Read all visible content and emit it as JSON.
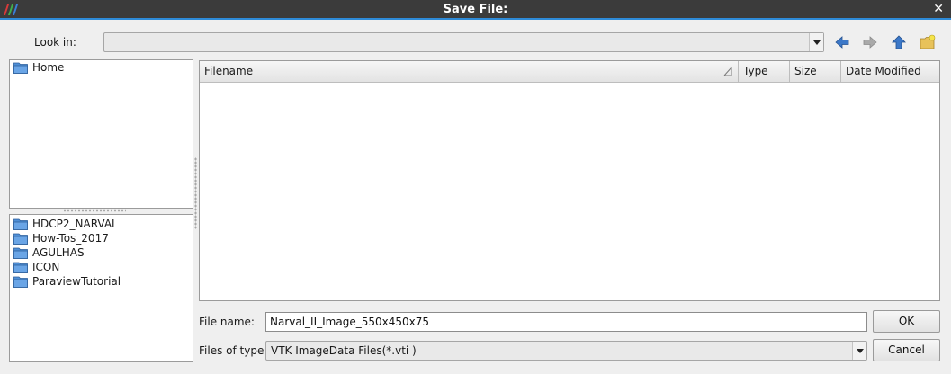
{
  "window": {
    "title": "Save File:",
    "close_glyph": "✕"
  },
  "look_in": {
    "label": "Look in:",
    "value": ""
  },
  "toolbar": {
    "icons": [
      "back-arrow-icon",
      "forward-arrow-icon",
      "parent-directory-icon",
      "new-folder-icon"
    ]
  },
  "places": {
    "top": [
      {
        "label": "Home",
        "icon": "folder-icon"
      }
    ],
    "bottom": [
      {
        "label": "HDCP2_NARVAL",
        "icon": "folder-icon"
      },
      {
        "label": "How-Tos_2017",
        "icon": "folder-icon"
      },
      {
        "label": "AGULHAS",
        "icon": "folder-icon"
      },
      {
        "label": "ICON",
        "icon": "folder-icon"
      },
      {
        "label": "ParaviewTutorial",
        "icon": "folder-icon"
      }
    ]
  },
  "file_list": {
    "columns": [
      "Filename",
      "Type",
      "Size",
      "Date Modified"
    ],
    "rows": []
  },
  "file_name": {
    "label": "File name:",
    "value": "Narval_II_Image_550x450x75"
  },
  "file_type": {
    "label": "Files of type:",
    "value": "VTK ImageData Files(*.vti )"
  },
  "buttons": {
    "ok": "OK",
    "cancel": "Cancel"
  },
  "colors": {
    "titlebar": "#3b3b3b",
    "accent": "#2e8bd8",
    "folder": "#4f8fd6"
  }
}
